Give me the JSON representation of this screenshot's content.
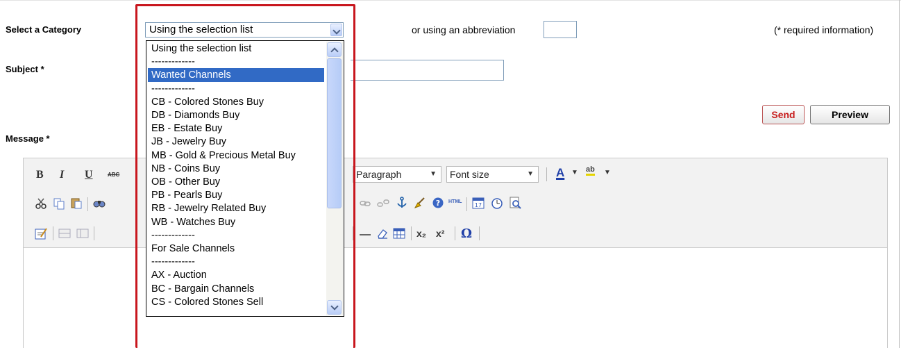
{
  "form": {
    "category_label": "Select a Category",
    "category_selected": "Using the selection list",
    "abbreviation_label": "or using an abbreviation",
    "abbreviation_value": "",
    "required_note": "(* required information)",
    "subject_label": "Subject *",
    "subject_value": "",
    "message_label": "Message *",
    "send_label": "Send",
    "preview_label": "Preview"
  },
  "toolbar": {
    "bold": "B",
    "italic": "I",
    "underline": "U",
    "strike": "ABC",
    "format_select": "Paragraph",
    "fontsize_select": "Font size",
    "font_color": "A",
    "highlight": "ab",
    "html_label": "HTML",
    "subscript": "x₂",
    "superscript": "x²",
    "omega": "Ω"
  },
  "dropdown": {
    "options": [
      "Using the selection list",
      "-------------",
      "Wanted Channels",
      "-------------",
      "CB - Colored Stones Buy",
      "DB - Diamonds Buy",
      "EB - Estate Buy",
      "JB - Jewelry Buy",
      "MB - Gold & Precious Metal Buy",
      "NB - Coins Buy",
      "OB - Other Buy",
      "PB - Pearls Buy",
      "RB - Jewelry Related Buy",
      "WB - Watches Buy",
      "-------------",
      "For Sale Channels",
      "-------------",
      "AX - Auction",
      "BC - Bargain Channels",
      "CS - Colored Stones Sell"
    ],
    "highlighted": "Wanted Channels"
  },
  "colors": {
    "highlight_box": "#c8161d",
    "selection": "#316ac5",
    "send_text": "#c71c1c"
  }
}
